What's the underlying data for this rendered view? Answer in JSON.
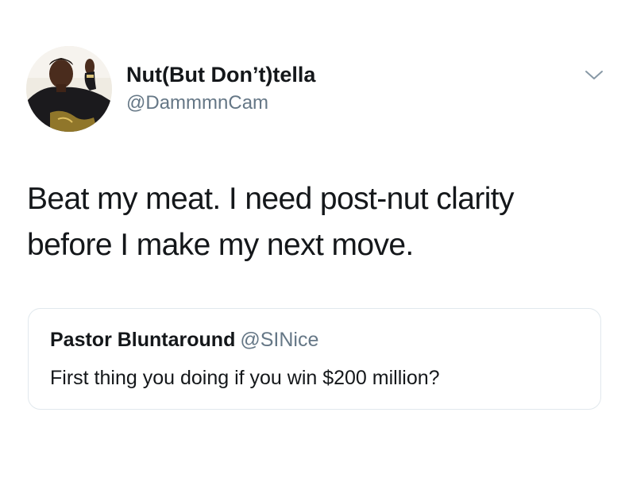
{
  "tweet": {
    "author": {
      "display_name": "Nut(But Don’t)tella",
      "handle": "@DammmnCam",
      "avatar_icon": "profile-photo"
    },
    "menu_icon": "chevron-down-icon",
    "text": "Beat my meat. I need post-nut clarity before I make my next move.",
    "quoted_tweet": {
      "display_name": "Pastor Bluntaround",
      "handle": "@SINice",
      "text": "First thing you doing if you win $200 million?"
    }
  },
  "colors": {
    "text_primary": "#14171a",
    "text_secondary": "#657786",
    "border": "#e1e8ed"
  }
}
